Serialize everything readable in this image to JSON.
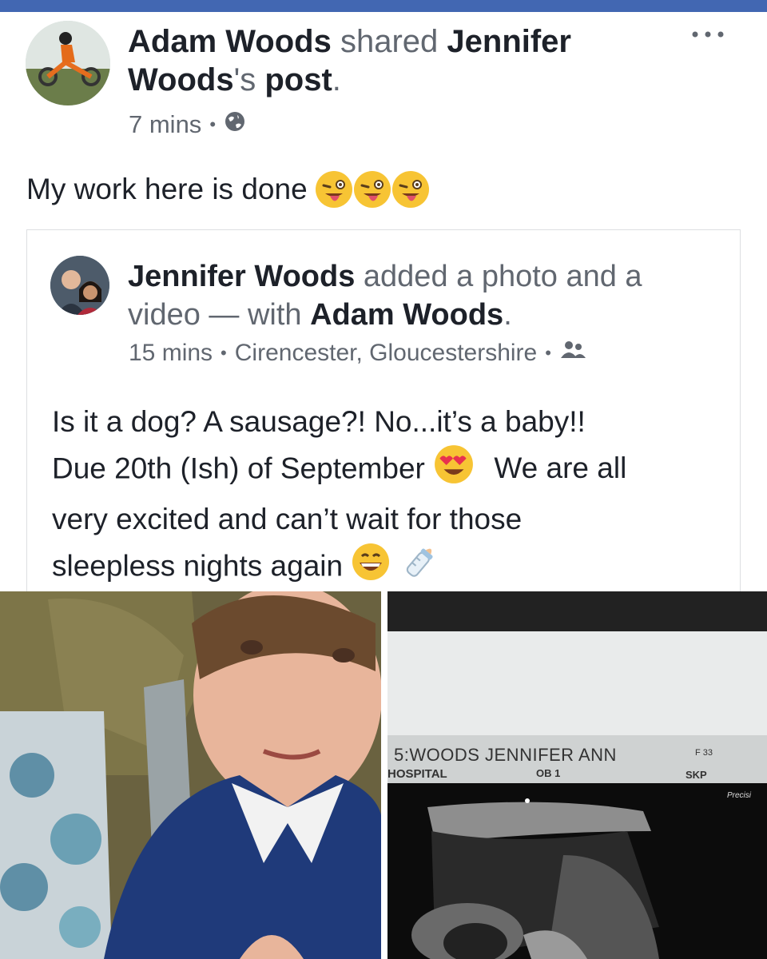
{
  "colors": {
    "brand": "#4267b2",
    "text": "#1d2129",
    "secondary": "#616770"
  },
  "post": {
    "sharer": "Adam Woods",
    "action": "shared",
    "owner": "Jennifer",
    "owner_last": "Woods",
    "possessive": "'s",
    "object": "post",
    "period": ".",
    "time": "7 mins",
    "privacy_icon": "globe-icon",
    "menu_icon": "more-options-icon",
    "status": "My work here is done",
    "status_emojis": [
      "tongue-wink-emoji",
      "tongue-wink-emoji",
      "tongue-wink-emoji"
    ]
  },
  "shared_post": {
    "author": "Jennifer Woods",
    "action": "added a photo and a video",
    "dash": "—",
    "with_label": "with",
    "tagged": "Adam Woods",
    "period": ".",
    "time": "15 mins",
    "location": "Cirencester, Gloucestershire",
    "privacy_icon": "friends-icon",
    "text_line1": "Is it a dog? A sausage?! No...it’s a baby!!",
    "text_line2a": "Due 20th (Ish) of September",
    "text_line2b": "We are all",
    "text_line3": "very excited and can’t wait for those",
    "text_line4": "sleepless nights again"
  },
  "media": {
    "scan_line1": "5:WOODS JENNIFER ANN",
    "scan_line2": "HOSPITAL",
    "scan_ob": "OB 1",
    "scan_f": "F 33",
    "scan_skp": "SKP",
    "scan_prec": "Precisi"
  }
}
